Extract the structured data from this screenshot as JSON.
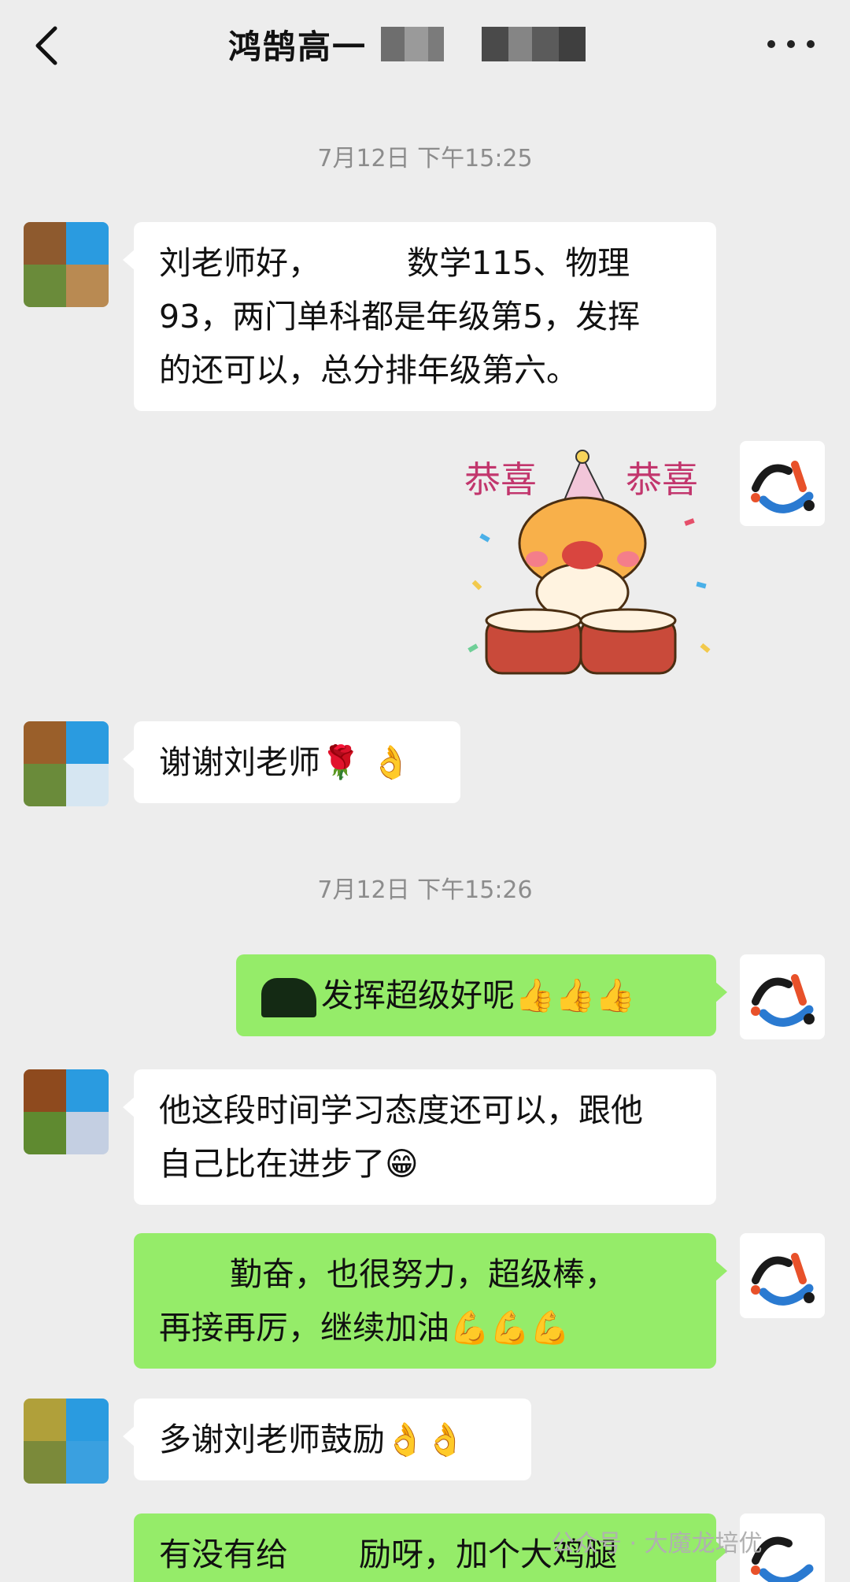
{
  "header": {
    "title": "鸿鹄高一"
  },
  "timestamps": [
    "7月12日 下午15:25",
    "7月12日 下午15:26"
  ],
  "messages": [
    {
      "side": "left",
      "lines": [
        "刘老师好，",
        "数学115、物理",
        "93，两门单科都是年级第5，发挥",
        "的还可以，总分排年级第六。"
      ]
    },
    {
      "side": "right",
      "type": "sticker",
      "sticker_text": [
        "恭喜",
        "恭喜"
      ]
    },
    {
      "side": "left",
      "text": "谢谢刘老师",
      "emoji": "🌹 👌"
    },
    {
      "side": "right",
      "text": "发挥超级好呢",
      "emoji": "👍👍👍"
    },
    {
      "side": "left",
      "lines": [
        "他这段时间学习态度还可以，跟他",
        "自己比在进步了"
      ],
      "emoji": "😁"
    },
    {
      "side": "right",
      "lines": [
        "勤奋，也很努力，超级棒，",
        "再接再厉，继续加油"
      ],
      "emoji": "💪💪💪"
    },
    {
      "side": "left",
      "text": "多谢刘老师鼓励",
      "emoji": "👌👌"
    },
    {
      "side": "right",
      "lines": [
        "有没有给",
        "励呀，加个大鸡腿"
      ]
    }
  ],
  "watermark": "公众号 · 大魔龙培优",
  "colors": {
    "background": "#ededed",
    "bubble_self": "#95ec69",
    "bubble_other": "#ffffff",
    "timestamp": "#8c8c8c"
  }
}
